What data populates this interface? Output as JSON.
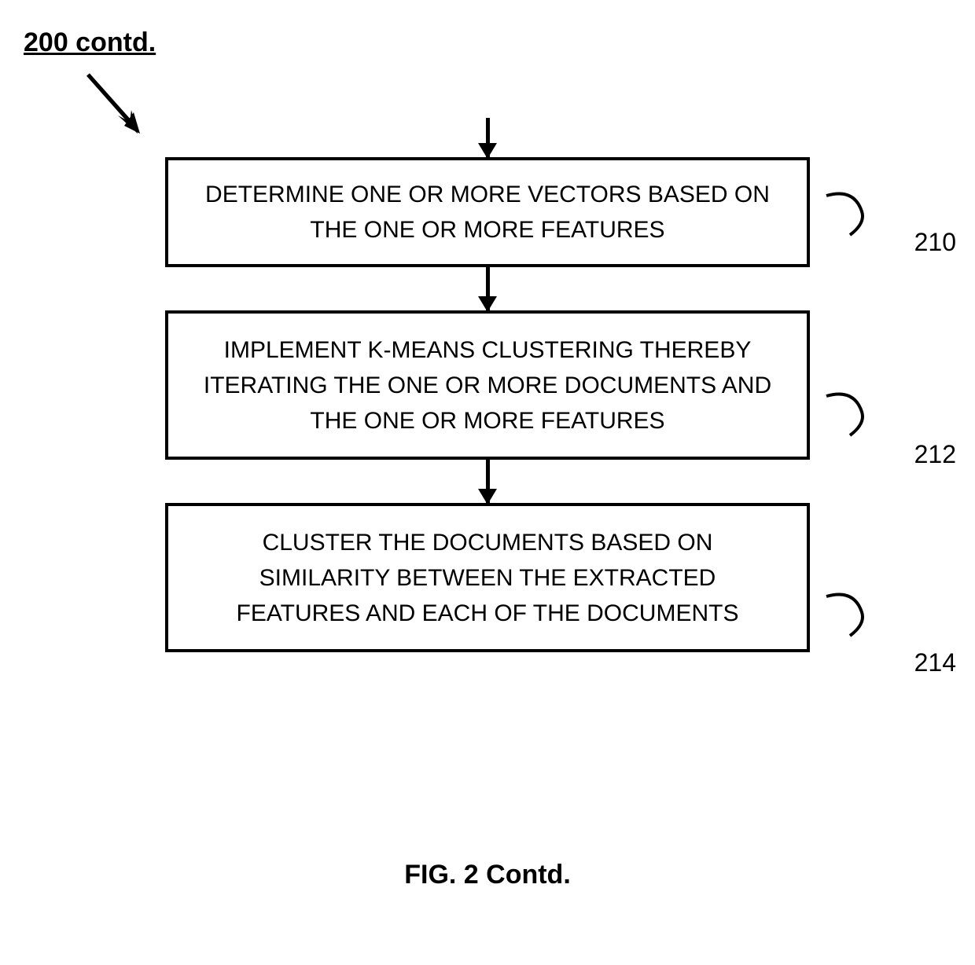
{
  "header": {
    "label": "200 contd."
  },
  "boxes": {
    "box1": {
      "text": "DETERMINE ONE OR MORE VECTORS BASED ON THE ONE OR MORE FEATURES",
      "ref": "210"
    },
    "box2": {
      "text": "IMPLEMENT K-MEANS CLUSTERING THEREBY ITERATING THE ONE OR MORE DOCUMENTS AND THE ONE OR MORE FEATURES",
      "ref": "212"
    },
    "box3": {
      "text": "CLUSTER THE DOCUMENTS BASED ON SIMILARITY BETWEEN THE EXTRACTED FEATURES AND EACH OF THE DOCUMENTS",
      "ref": "214"
    }
  },
  "caption": "FIG. 2 Contd."
}
